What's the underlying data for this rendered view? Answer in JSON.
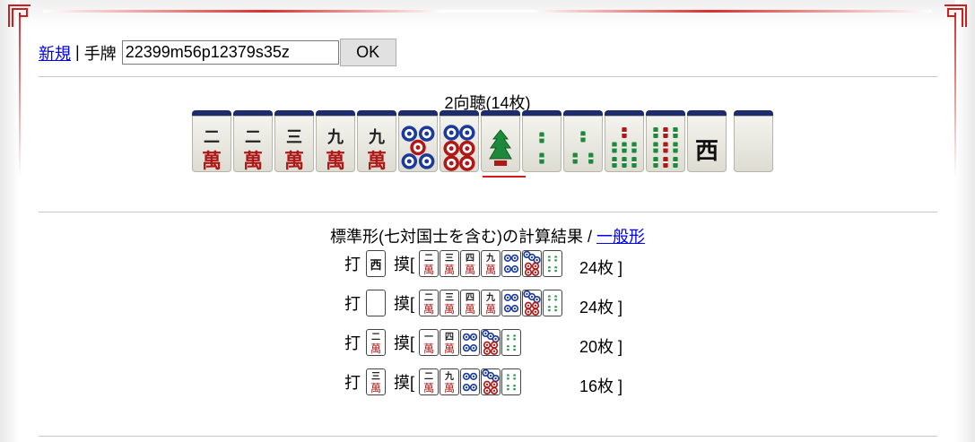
{
  "form": {
    "new_link": "新規",
    "separator": "|",
    "hand_label": "手牌",
    "hand_value": "22399m56p12379s35z",
    "ok_label": "OK"
  },
  "hand": {
    "summary": "2向聴(14枚)",
    "tiles": [
      {
        "id": "2m",
        "char": "二",
        "suit": "萬",
        "icon": "manzu-2"
      },
      {
        "id": "2m",
        "char": "二",
        "suit": "萬",
        "icon": "manzu-2"
      },
      {
        "id": "3m",
        "char": "三",
        "suit": "萬",
        "icon": "manzu-3"
      },
      {
        "id": "9m",
        "char": "九",
        "suit": "萬",
        "icon": "manzu-9"
      },
      {
        "id": "9m",
        "char": "九",
        "suit": "萬",
        "icon": "manzu-9"
      },
      {
        "id": "5p",
        "icon": "pinzu-5"
      },
      {
        "id": "6p",
        "icon": "pinzu-6"
      },
      {
        "id": "1s",
        "icon": "souzu-1-bird"
      },
      {
        "id": "2s",
        "icon": "souzu-2"
      },
      {
        "id": "3s",
        "icon": "souzu-3"
      },
      {
        "id": "7s",
        "icon": "souzu-7"
      },
      {
        "id": "9s",
        "icon": "souzu-9"
      },
      {
        "id": "3z",
        "char": "西",
        "icon": "west-wind"
      },
      {
        "id": "5z",
        "char": "",
        "icon": "white-dragon"
      }
    ]
  },
  "results": {
    "title": "標準形(七対国士を含む)の計算結果 /",
    "alt_link": "一般形",
    "discard_label": "打",
    "draw_label": "摸[",
    "close_bracket": "]",
    "rows": [
      {
        "discard": {
          "type": "honor",
          "char": "西"
        },
        "draws": [
          {
            "type": "man",
            "char": "二"
          },
          {
            "type": "man",
            "char": "三"
          },
          {
            "type": "man",
            "char": "四"
          },
          {
            "type": "man",
            "char": "九"
          },
          {
            "type": "pin",
            "n": 4
          },
          {
            "type": "pin",
            "n": 7
          },
          {
            "type": "sou",
            "n": 4
          }
        ],
        "count": "24枚"
      },
      {
        "discard": {
          "type": "honor",
          "char": ""
        },
        "draws": [
          {
            "type": "man",
            "char": "二"
          },
          {
            "type": "man",
            "char": "三"
          },
          {
            "type": "man",
            "char": "四"
          },
          {
            "type": "man",
            "char": "九"
          },
          {
            "type": "pin",
            "n": 4
          },
          {
            "type": "pin",
            "n": 7
          },
          {
            "type": "sou",
            "n": 4
          }
        ],
        "count": "24枚"
      },
      {
        "discard": {
          "type": "man",
          "char": "二"
        },
        "draws": [
          {
            "type": "man",
            "char": "一"
          },
          {
            "type": "man",
            "char": "四"
          },
          {
            "type": "pin",
            "n": 4
          },
          {
            "type": "pin",
            "n": 7
          },
          {
            "type": "sou",
            "n": 4
          }
        ],
        "count": "20枚"
      },
      {
        "discard": {
          "type": "man",
          "char": "三"
        },
        "draws": [
          {
            "type": "man",
            "char": "二"
          },
          {
            "type": "man",
            "char": "九"
          },
          {
            "type": "pin",
            "n": 4
          },
          {
            "type": "pin",
            "n": 7
          },
          {
            "type": "sou",
            "n": 4
          }
        ],
        "count": "16枚"
      }
    ]
  },
  "colors": {
    "accent": "#d21d1d",
    "link": "#0000ee",
    "tile_back": "#1e2b6e",
    "pin_blue": "#1b3a9a",
    "sou_green": "#1c8a3a",
    "man_red": "#b01818"
  }
}
